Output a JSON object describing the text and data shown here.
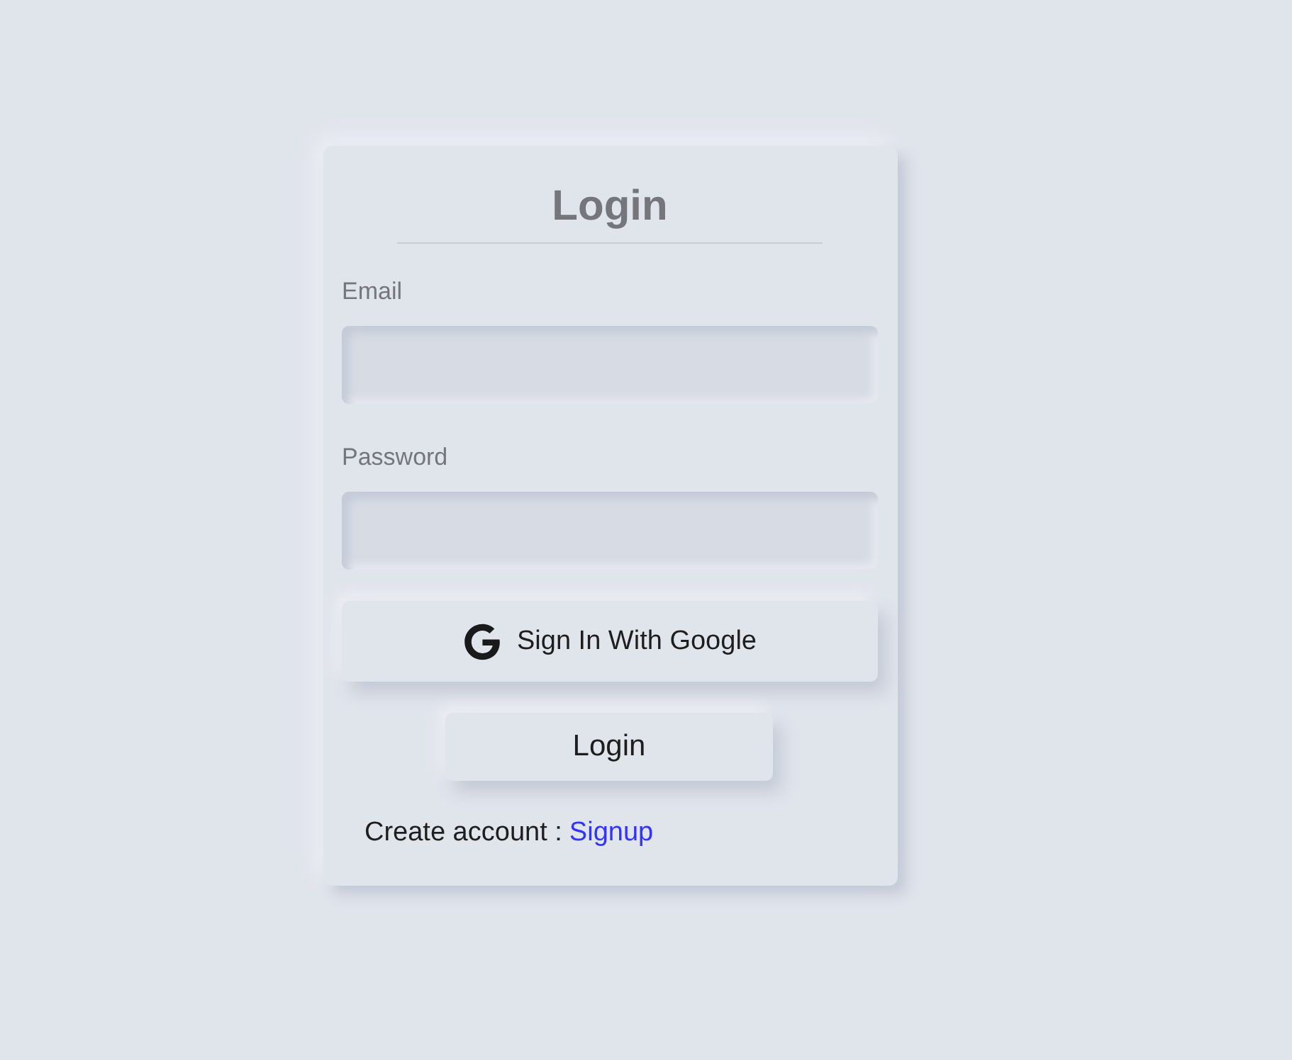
{
  "title": "Login",
  "fields": [
    {
      "label": "Email"
    },
    {
      "label": "Password"
    }
  ],
  "google_button": {
    "label": "Sign In With Google"
  },
  "login_button": {
    "label": "Login"
  },
  "signup": {
    "text": "Create account :",
    "link": "Signup"
  }
}
